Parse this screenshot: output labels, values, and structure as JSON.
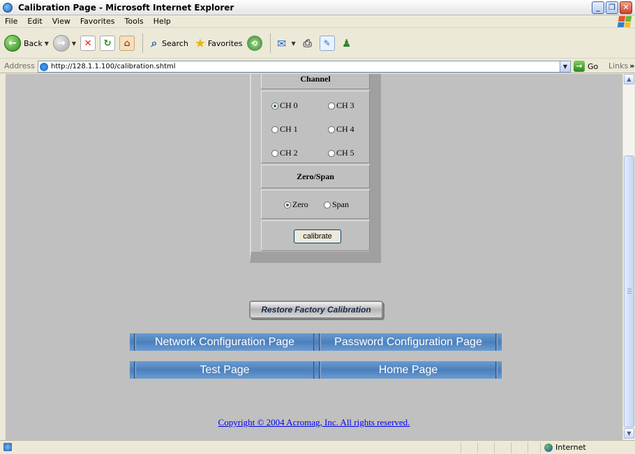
{
  "window": {
    "title": "Calibration Page - Microsoft Internet Explorer",
    "buttons": [
      "_",
      "❐",
      "✕"
    ]
  },
  "menu": [
    "File",
    "Edit",
    "View",
    "Favorites",
    "Tools",
    "Help"
  ],
  "toolbar": {
    "back_label": "Back",
    "search_label": "Search",
    "favorites_label": "Favorites"
  },
  "address": {
    "label": "Address",
    "url": "http://128.1.1.100/calibration.shtml",
    "go_label": "Go",
    "links_label": "Links"
  },
  "calibration": {
    "channel_heading": "Channel",
    "channels": [
      {
        "label": "CH 0",
        "checked": true
      },
      {
        "label": "CH 3",
        "checked": false
      },
      {
        "label": "CH 1",
        "checked": false
      },
      {
        "label": "CH 4",
        "checked": false
      },
      {
        "label": "CH 2",
        "checked": false
      },
      {
        "label": "CH 5",
        "checked": false
      }
    ],
    "zero_span_heading": "Zero/Span",
    "zero_label": "Zero",
    "span_label": "Span",
    "selected": "Zero",
    "calibrate_label": "calibrate"
  },
  "restore_label": "Restore Factory Calibration",
  "nav": {
    "network": "Network Configuration Page",
    "password": "Password Configuration Page",
    "test": "Test Page",
    "home": "Home Page"
  },
  "copyright": "Copyright © 2004 Acromag, Inc. All rights reserved.",
  "status": {
    "zone": "Internet"
  },
  "colors": {
    "nav_blue": "#4b80bd",
    "content_bg": "#c0c0c0",
    "link": "#0000ee"
  }
}
